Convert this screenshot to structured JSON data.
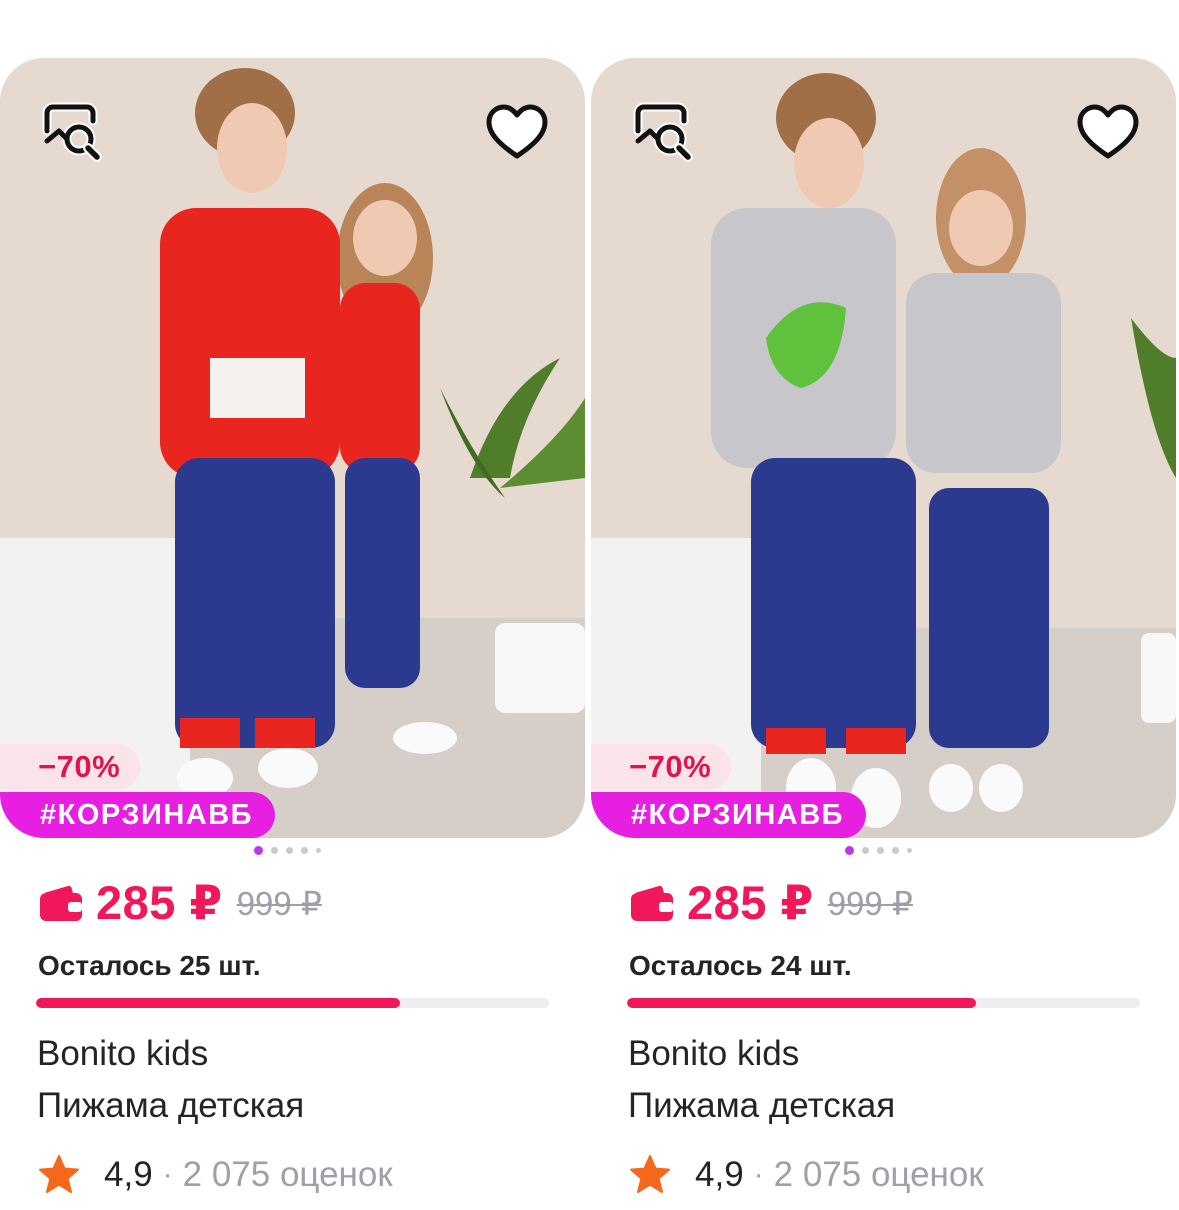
{
  "colors": {
    "accent": "#f0175a",
    "tag": "#e61fe0",
    "discount_bg": "#fbe3ea",
    "star": "#f4671d",
    "muted": "#9f9fab"
  },
  "icons": {
    "search_photo": "similar-search-icon",
    "favorite": "heart-icon",
    "wallet": "wallet-icon",
    "star": "star-icon"
  },
  "products": [
    {
      "discount": "−70%",
      "tag": "#КОРЗИНАВБ",
      "price": "285 ₽",
      "old_price": "999 ₽",
      "stock_text": "Осталось 25 шт.",
      "stock_progress": 0.71,
      "brand": "Bonito kids",
      "name": "Пижама детская",
      "rating": "4,9",
      "separator": "·",
      "reviews": "2 075 оценок",
      "image_dots": 5,
      "active_dot": 0,
      "shirt_color": "#e8261f"
    },
    {
      "discount": "−70%",
      "tag": "#КОРЗИНАВБ",
      "price": "285 ₽",
      "old_price": "999 ₽",
      "stock_text": "Осталось 24 шт.",
      "stock_progress": 0.68,
      "brand": "Bonito kids",
      "name": "Пижама детская",
      "rating": "4,9",
      "separator": "·",
      "reviews": "2 075 оценок",
      "image_dots": 5,
      "active_dot": 0,
      "shirt_color": "#c7c7cb"
    }
  ]
}
